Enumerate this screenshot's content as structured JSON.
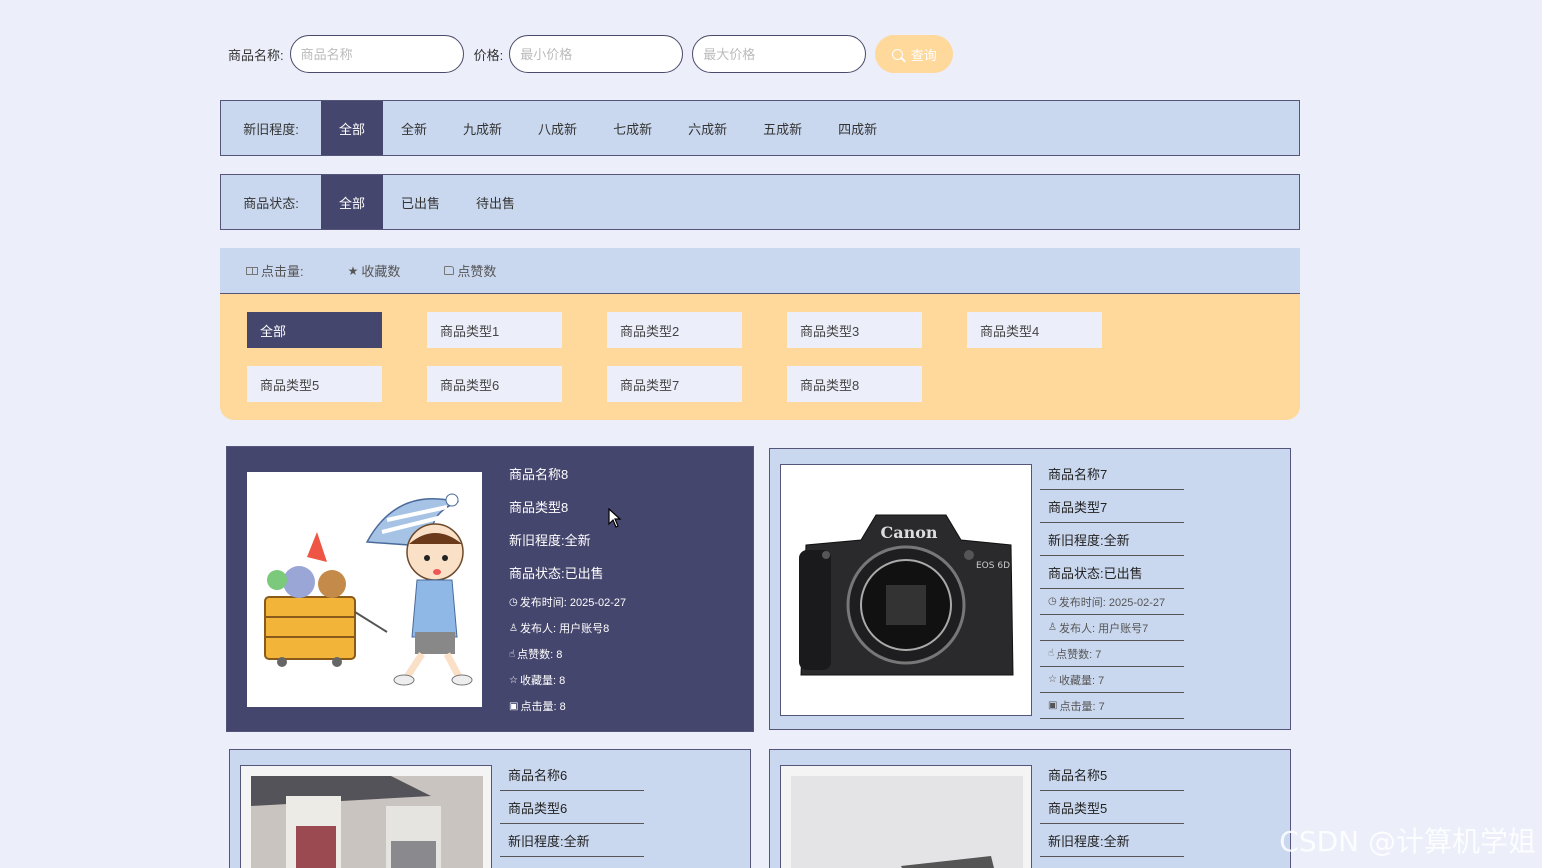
{
  "search": {
    "name_label": "商品名称:",
    "name_placeholder": "商品名称",
    "price_label": "价格:",
    "min_placeholder": "最小价格",
    "max_placeholder": "最大价格",
    "query_label": "查询"
  },
  "condition_filter": {
    "title": "新旧程度:",
    "options": [
      "全部",
      "全新",
      "九成新",
      "八成新",
      "七成新",
      "六成新",
      "五成新",
      "四成新"
    ],
    "active": "全部"
  },
  "status_filter": {
    "title": "商品状态:",
    "options": [
      "全部",
      "已出售",
      "待出售"
    ],
    "active": "全部"
  },
  "sort": {
    "clicks": "点击量:",
    "favorites": "收藏数",
    "likes": "点赞数"
  },
  "categories": [
    "全部",
    "商品类型1",
    "商品类型2",
    "商品类型3",
    "商品类型4",
    "商品类型5",
    "商品类型6",
    "商品类型7",
    "商品类型8"
  ],
  "products": [
    {
      "name": "商品名称8",
      "type": "商品类型8",
      "condition": "新旧程度:全新",
      "status": "商品状态:已出售",
      "time": "发布时间:  2025-02-27",
      "publisher": "发布人:  用户账号8",
      "likes": "点赞数:  8",
      "favorites": "收藏量:  8",
      "clicks": "点击量:  8",
      "image": "cartoon-boy-with-toy-cart"
    },
    {
      "name": "商品名称7",
      "type": "商品类型7",
      "condition": "新旧程度:全新",
      "status": "商品状态:已出售",
      "time": "发布时间:  2025-02-27",
      "publisher": "发布人:  用户账号7",
      "likes": "点赞数:  7",
      "favorites": "收藏量:  7",
      "clicks": "点击量:  7",
      "image": "canon-camera",
      "camera_brand": "Canon",
      "camera_model": "EOS 6D"
    },
    {
      "name": "商品名称6",
      "type": "商品类型6",
      "condition": "新旧程度:全新",
      "image": "bags-photo"
    },
    {
      "name": "商品名称5",
      "type": "商品类型5",
      "condition": "新旧程度:全新",
      "image": "grey-photo"
    }
  ],
  "watermark": "CSDN @计算机学姐"
}
